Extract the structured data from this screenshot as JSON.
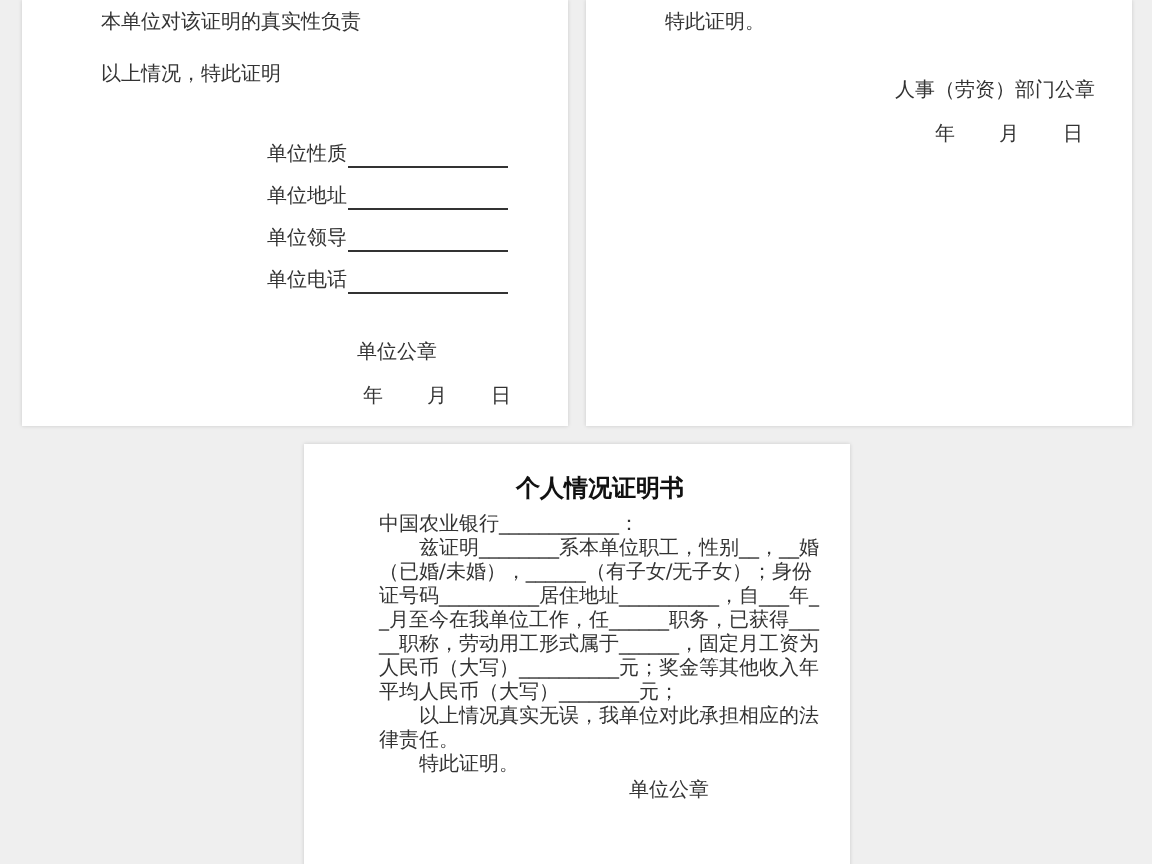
{
  "pages": [
    {
      "kind": "form",
      "lines": [
        "本单位对该证明的真实性负责",
        "以上情况，特此证明"
      ],
      "fields": [
        "单位性质",
        "单位地址",
        "单位领导",
        "单位电话"
      ],
      "seal": "单位公章",
      "date": [
        "年",
        "月",
        "日"
      ]
    },
    {
      "kind": "form",
      "lines": [
        "特此证明。"
      ],
      "seal": "人事（劳资）部门公章",
      "date": [
        "年",
        "月",
        "日"
      ]
    },
    {
      "kind": "certificate",
      "title": "个人情况证明书",
      "addressee": "中国农业银行____________：",
      "paragraphs": [
        "兹证明________系本单位职工，性别__，__婚（已婚/未婚），______（有子女/无子女）；身份证号码__________居住地址__________，自___年__月至今在我单位工作，任______职务，已获得_____职称，劳动用工形式属于______，固定月工资为人民币（大写）__________元；奖金等其他收入年平均人民币（大写）________元；",
        "以上情况真实无误，我单位对此承担相应的法律责任。"
      ],
      "closing": "特此证明。",
      "seal": "单位公章"
    }
  ]
}
